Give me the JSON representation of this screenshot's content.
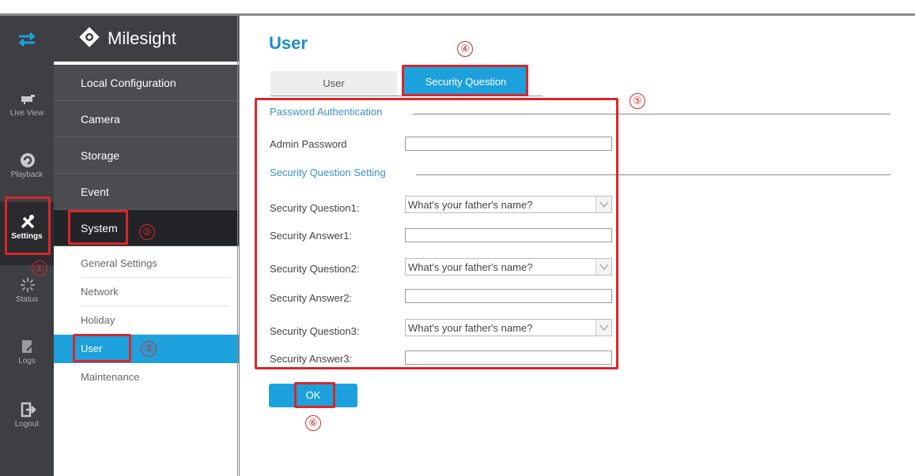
{
  "rail": {
    "items": [
      {
        "label": "Live View",
        "icon": "live-view-icon"
      },
      {
        "label": "Playback",
        "icon": "playback-icon"
      },
      {
        "label": "Settings",
        "icon": "settings-icon"
      },
      {
        "label": "Status",
        "icon": "status-icon"
      },
      {
        "label": "Logs",
        "icon": "logs-icon"
      },
      {
        "label": "Logout",
        "icon": "logout-icon"
      }
    ]
  },
  "brand": {
    "name": "Milesight"
  },
  "menu": {
    "main": [
      "Local Configuration",
      "Camera",
      "Storage",
      "Event",
      "System"
    ],
    "sub": [
      "General Settings",
      "Network",
      "Holiday",
      "User",
      "Maintenance"
    ]
  },
  "page": {
    "title": "User",
    "tabs": [
      "User",
      "Security Question"
    ]
  },
  "form": {
    "password_section": "Password Authentication",
    "admin_password_label": "Admin Password",
    "question_section": "Security Question Setting",
    "questions": [
      {
        "q_label": "Security Question1:",
        "q_value": "What's your father's name?",
        "a_label": "Security Answer1:"
      },
      {
        "q_label": "Security Question2:",
        "q_value": "What's your father's name?",
        "a_label": "Security Answer2:"
      },
      {
        "q_label": "Security Question3:",
        "q_value": "What's your father's name?",
        "a_label": "Security Answer3:"
      }
    ],
    "ok_label": "OK"
  },
  "annotations": [
    "①",
    "②",
    "③",
    "④",
    "⑤",
    "⑥"
  ],
  "colors": {
    "accent": "#1da1dc",
    "annotation": "#d9262b",
    "sidebar": "#3d3f43"
  }
}
